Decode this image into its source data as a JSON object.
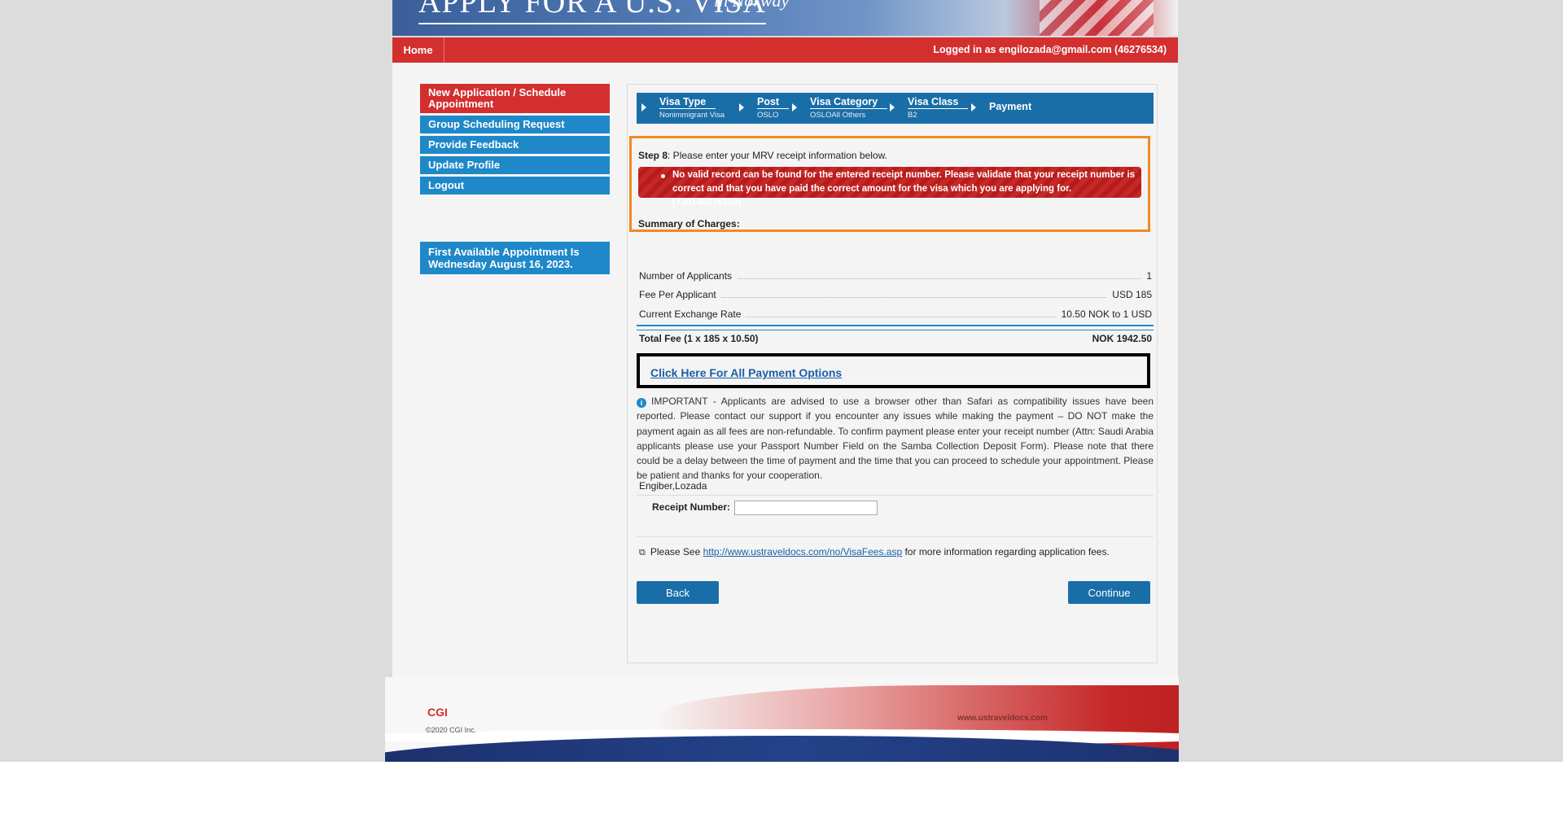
{
  "banner": {
    "title": "APPLY FOR A U.S. VISA",
    "subtitle": "in Norway"
  },
  "topnav": {
    "home": "Home",
    "logged_in": "Logged in as  engilozada@gmail.com (46276534)"
  },
  "left_menu": {
    "items": [
      {
        "label": "New Application / Schedule Appointment"
      },
      {
        "label": "Group Scheduling Request"
      },
      {
        "label": "Provide Feedback"
      },
      {
        "label": "Update Profile"
      },
      {
        "label": "Logout"
      }
    ],
    "first_available": "First Available Appointment Is Wednesday August 16, 2023."
  },
  "steps": [
    {
      "title": "Visa Type",
      "sub": "Nonimmigrant Visa"
    },
    {
      "title": "Post",
      "sub": "OSLO"
    },
    {
      "title": "Visa Category",
      "sub": "OSLOAll Others"
    },
    {
      "title": "Visa Class",
      "sub": "B2"
    },
    {
      "title": "Payment",
      "sub": ""
    }
  ],
  "step_info": {
    "step_label": "Step 8",
    "step_text": ": Please enter your MRV receipt information below.",
    "error": "No valid record can be found for the entered receipt number. Please validate that your receipt number is correct and that you have paid the correct amount for the visa which you are applying for. [730146276534]",
    "summary_label": "Summary of Charges:"
  },
  "charges": [
    {
      "label": "Number of Applicants",
      "value": "1"
    },
    {
      "label": "Fee Per Applicant",
      "value": "USD 185"
    },
    {
      "label": "Current Exchange Rate",
      "value": "10.50 NOK to 1 USD"
    }
  ],
  "total": {
    "label": "Total Fee (1 x 185 x 10.50)",
    "value": "NOK 1942.50"
  },
  "payment_options_link": "Click Here For All Payment Options",
  "important_text": "IMPORTANT - Applicants are advised to use a browser other than Safari as compatibility issues have been reported. Please contact our support if you encounter any issues while making the payment – DO NOT make the payment again as all fees are non-refundable. To confirm payment please enter your receipt number (Attn: Saudi Arabia applicants please use your Passport Number Field on the Samba Collection Deposit Form). Please note that there could be a delay between the time of payment and the time that you can proceed to schedule your appointment. Please be patient and thanks for your cooperation.",
  "applicant_name": "Engiber,Lozada",
  "receipt": {
    "label": "Receipt Number:",
    "value": ""
  },
  "see_info": {
    "prefix": "Please See ",
    "link": "http://www.ustraveldocs.com/no/VisaFees.asp",
    "suffix": " for more information regarding application fees."
  },
  "buttons": {
    "back": "Back",
    "continue": "Continue"
  },
  "footer": {
    "logo": "CGI",
    "copyright": "©2020 CGI Inc.",
    "url": "www.ustraveldocs.com"
  }
}
